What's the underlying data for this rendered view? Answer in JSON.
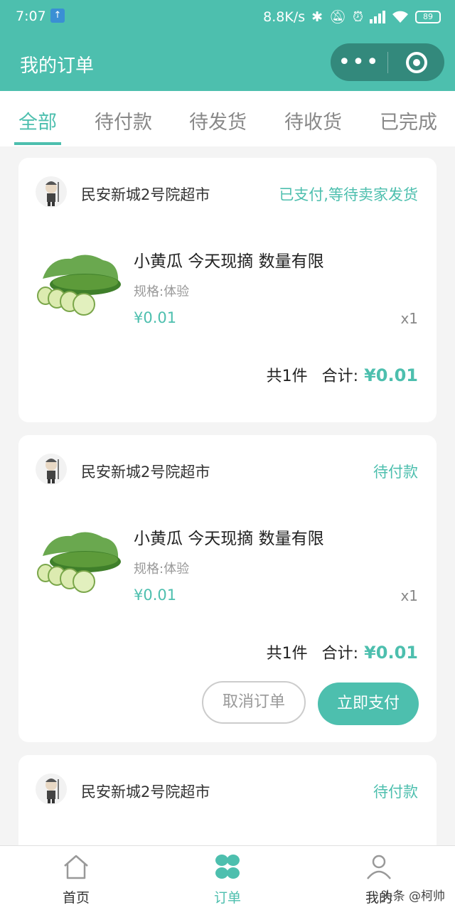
{
  "status_bar": {
    "time": "7:07",
    "speed": "8.8K/s",
    "battery": "89",
    "upload_icon": "↑"
  },
  "header": {
    "title": "我的订单",
    "menu_dots": "•••"
  },
  "tabs": [
    "全部",
    "待付款",
    "待发货",
    "待收货",
    "已完成"
  ],
  "orders": [
    {
      "store": "民安新城2号院超市",
      "status": "已支付,等待卖家发货",
      "product": "小黄瓜 今天现摘 数量有限",
      "spec": "规格:体验",
      "price": "¥0.01",
      "qty": "x1",
      "count": "共1件",
      "total_label": "合计:",
      "total": "¥0.01"
    },
    {
      "store": "民安新城2号院超市",
      "status": "待付款",
      "product": "小黄瓜 今天现摘 数量有限",
      "spec": "规格:体验",
      "price": "¥0.01",
      "qty": "x1",
      "count": "共1件",
      "total_label": "合计:",
      "total": "¥0.01",
      "cancel_btn": "取消订单",
      "pay_btn": "立即支付"
    },
    {
      "store": "民安新城2号院超市",
      "status": "待付款"
    }
  ],
  "nav": [
    {
      "label": "首页",
      "icon": "home-icon"
    },
    {
      "label": "订单",
      "icon": "orders-icon"
    },
    {
      "label": "我的",
      "icon": "user-icon"
    }
  ],
  "watermark": "头条 @柯帅",
  "colors": {
    "accent": "#4dbfae"
  }
}
